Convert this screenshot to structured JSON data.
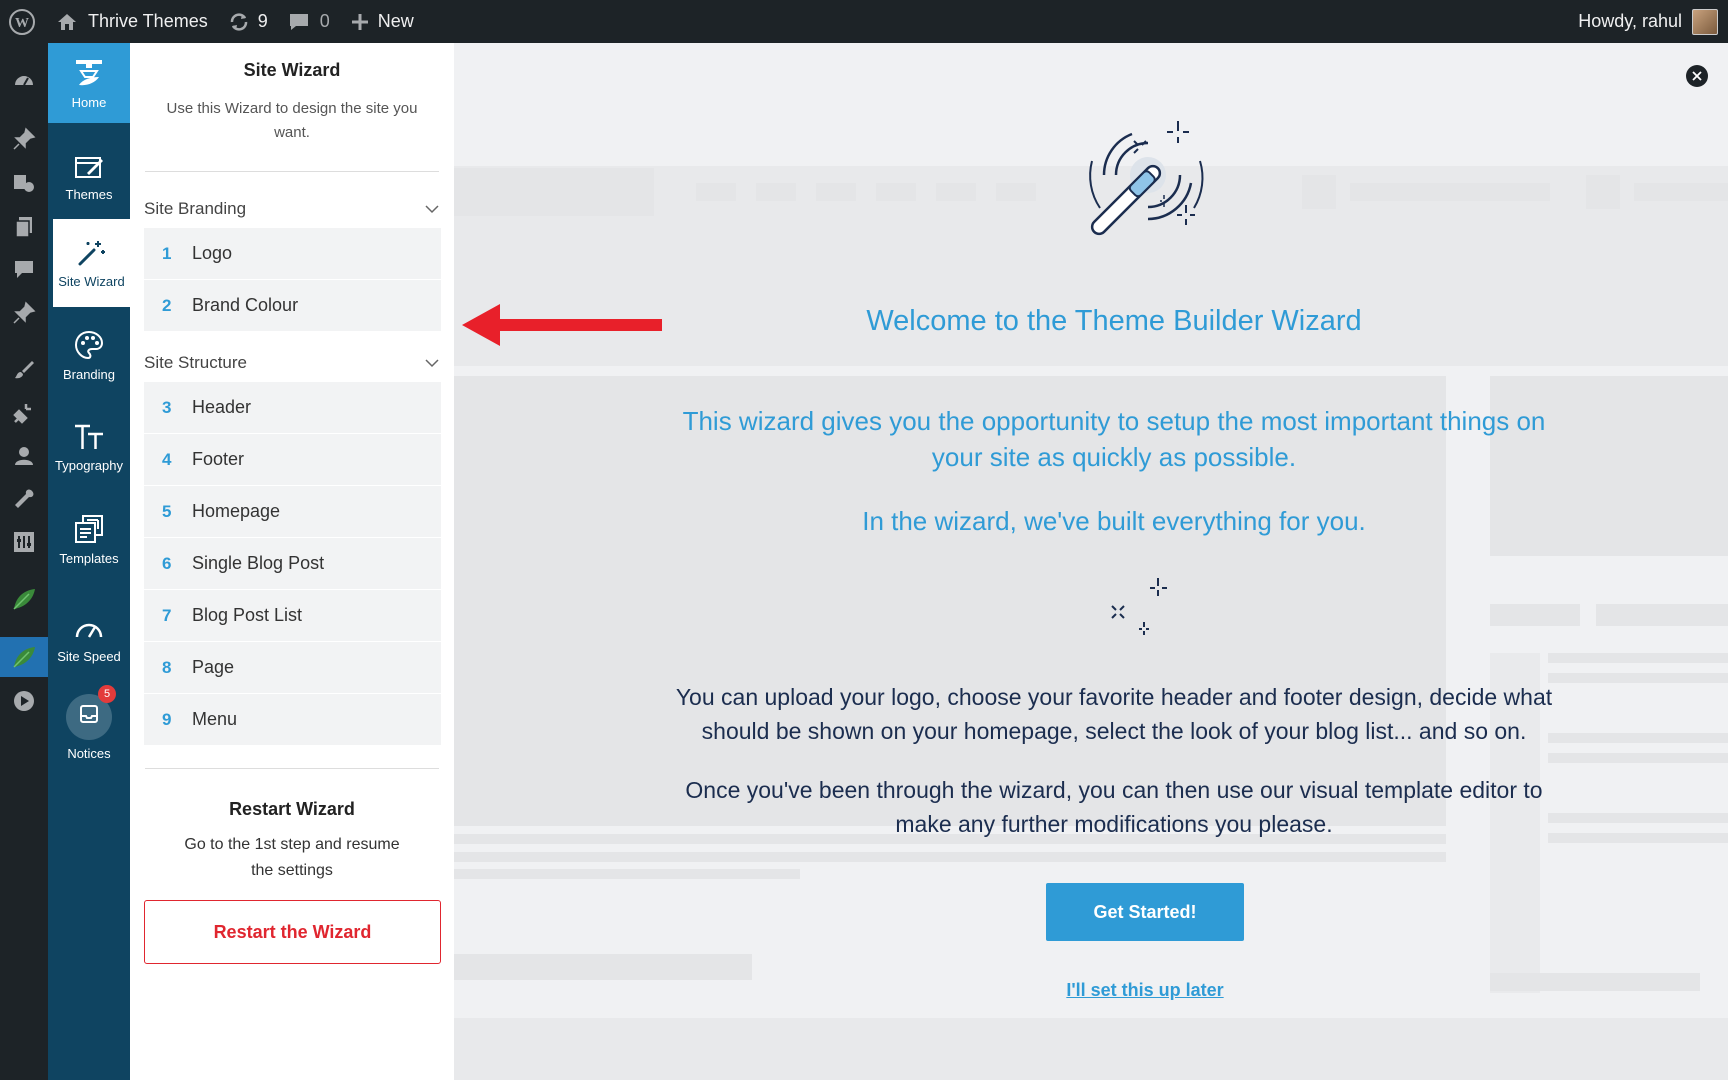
{
  "adminbar": {
    "site_name": "Thrive Themes",
    "updates_count": "9",
    "comments_count": "0",
    "new_label": "New",
    "howdy": "Howdy, rahul"
  },
  "thrive_nav": {
    "home": "Home",
    "themes": "Themes",
    "site_wizard": "Site Wizard",
    "branding": "Branding",
    "typography": "Typography",
    "templates": "Templates",
    "site_speed": "Site Speed",
    "notices": "Notices",
    "notices_badge": "5"
  },
  "panel": {
    "title": "Site Wizard",
    "description": "Use this Wizard to design the site you want.",
    "branding_section": "Site Branding",
    "branding_steps": [
      {
        "num": "1",
        "label": "Logo"
      },
      {
        "num": "2",
        "label": "Brand Colour"
      }
    ],
    "structure_section": "Site Structure",
    "structure_steps": [
      {
        "num": "3",
        "label": "Header"
      },
      {
        "num": "4",
        "label": "Footer"
      },
      {
        "num": "5",
        "label": "Homepage"
      },
      {
        "num": "6",
        "label": "Single Blog Post"
      },
      {
        "num": "7",
        "label": "Blog Post List"
      },
      {
        "num": "8",
        "label": "Page"
      },
      {
        "num": "9",
        "label": "Menu"
      }
    ],
    "restart_title": "Restart Wizard",
    "restart_desc": "Go to the 1st step and resume the settings",
    "restart_button": "Restart the Wizard"
  },
  "main": {
    "welcome_title": "Welcome to the Theme Builder Wizard",
    "lead_1": "This wizard gives you the opportunity to setup the most important things on your site as quickly as possible.",
    "lead_2": "In the wizard, we've built everything for you.",
    "body_1": "You can upload your logo, choose your favorite header and footer design, decide what should be shown on your homepage, select the look of your blog list... and so on.",
    "body_2": "Once you've been through the wizard, you can then use our visual template editor to make any further modifications you please.",
    "get_started": "Get Started!",
    "later_link": "I'll set this up later"
  },
  "colors": {
    "accent": "#2f9bd6",
    "thrive_nav": "#0f4461",
    "restart_red": "#e0262f",
    "arrow_red": "#e8202a"
  }
}
